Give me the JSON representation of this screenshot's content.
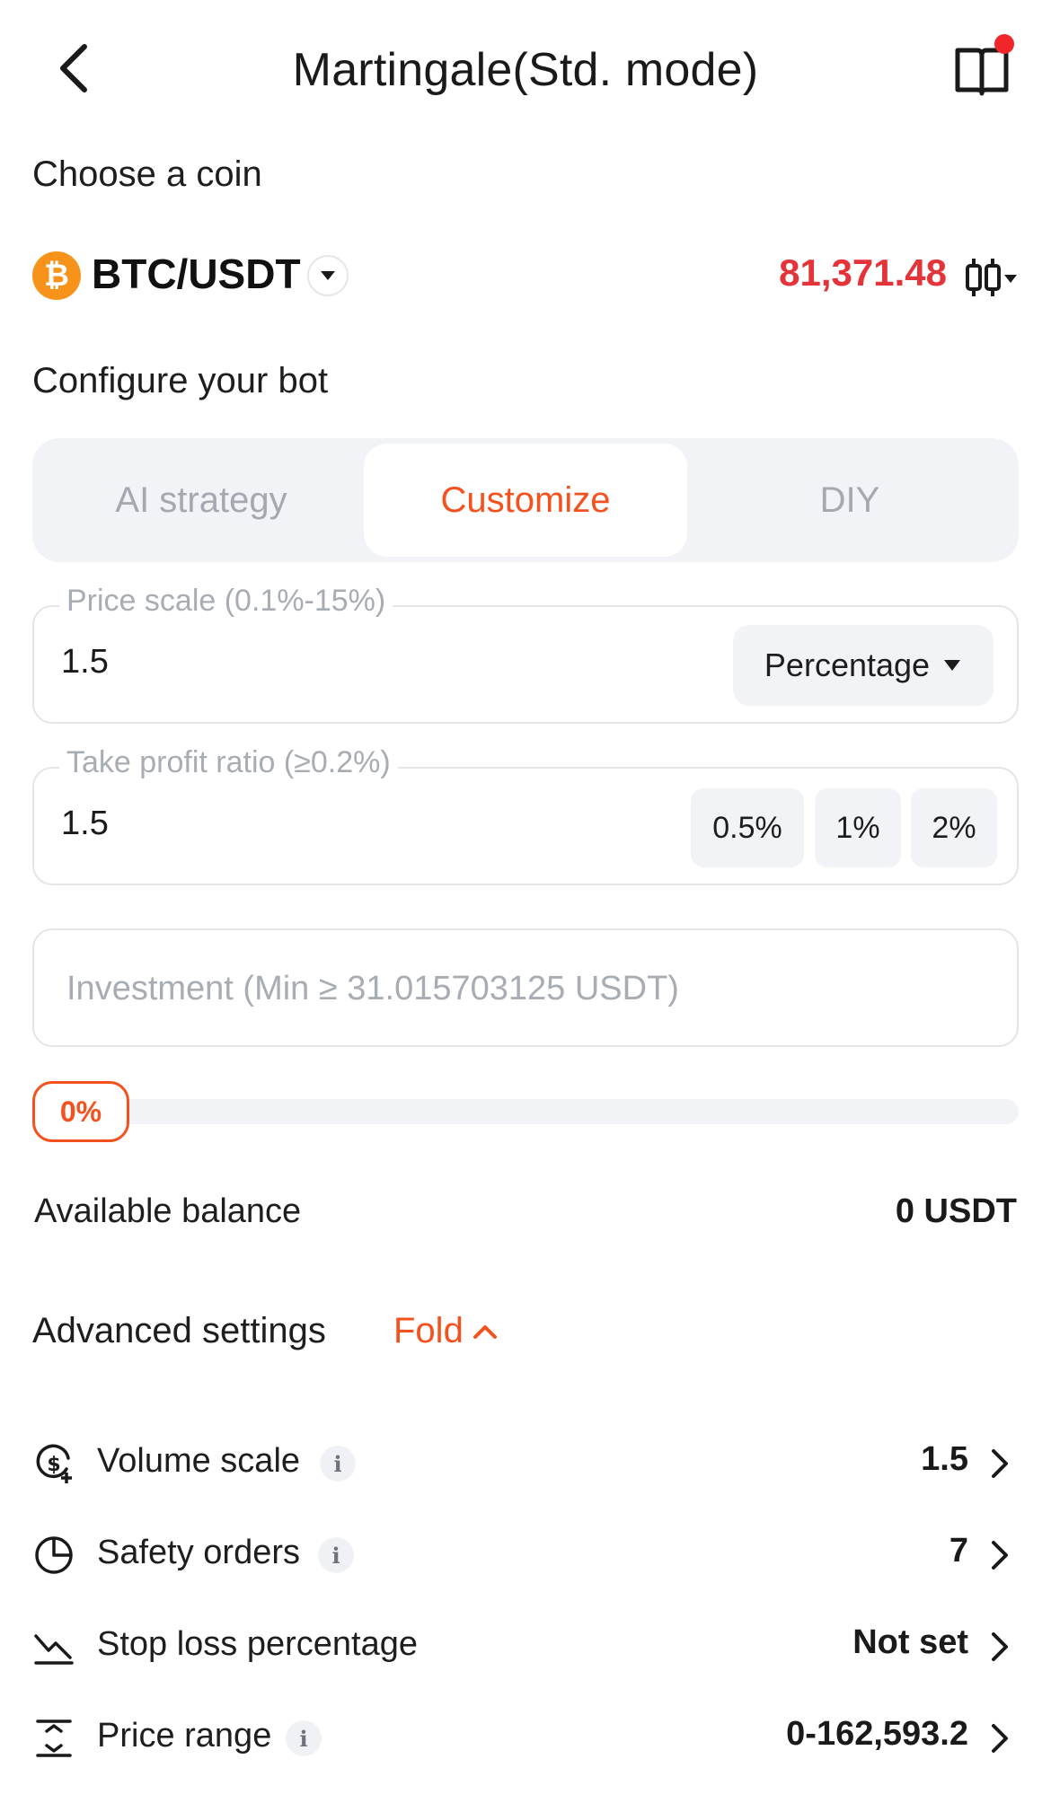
{
  "header": {
    "title": "Martingale(Std. mode)"
  },
  "coin_section": {
    "label": "Choose a coin",
    "logo_glyph": "₿",
    "pair": "BTC/USDT",
    "price": "81,371.48",
    "price_color": "#e5333a"
  },
  "config": {
    "label": "Configure your bot",
    "tabs": [
      {
        "label": "AI strategy",
        "active": false
      },
      {
        "label": "Customize",
        "active": true
      },
      {
        "label": "DIY",
        "active": false
      }
    ],
    "accent": "#f4511e"
  },
  "price_scale": {
    "legend": "Price scale (0.1%-15%)",
    "value": "1.5",
    "unit": "Percentage"
  },
  "take_profit": {
    "legend": "Take profit ratio (≥0.2%)",
    "value": "1.5",
    "presets": [
      "0.5%",
      "1%",
      "2%"
    ]
  },
  "investment": {
    "placeholder": "Investment (Min ≥ 31.015703125 USDT)"
  },
  "slider": {
    "label": "0%",
    "level": 0
  },
  "balance": {
    "label": "Available balance",
    "value": "0 USDT"
  },
  "advanced": {
    "title": "Advanced settings",
    "fold_label": "Fold",
    "rows": [
      {
        "icon": "dollar-cycle-icon",
        "label": "Volume scale",
        "info": "i",
        "value": "1.5"
      },
      {
        "icon": "pie-chart-icon",
        "label": "Safety orders",
        "info": "i",
        "value": "7"
      },
      {
        "icon": "trend-down-icon",
        "label": "Stop loss percentage",
        "info": "",
        "value": "Not set"
      },
      {
        "icon": "price-range-icon",
        "label": "Price range",
        "info": "i",
        "value": "0-162,593.2"
      }
    ]
  }
}
